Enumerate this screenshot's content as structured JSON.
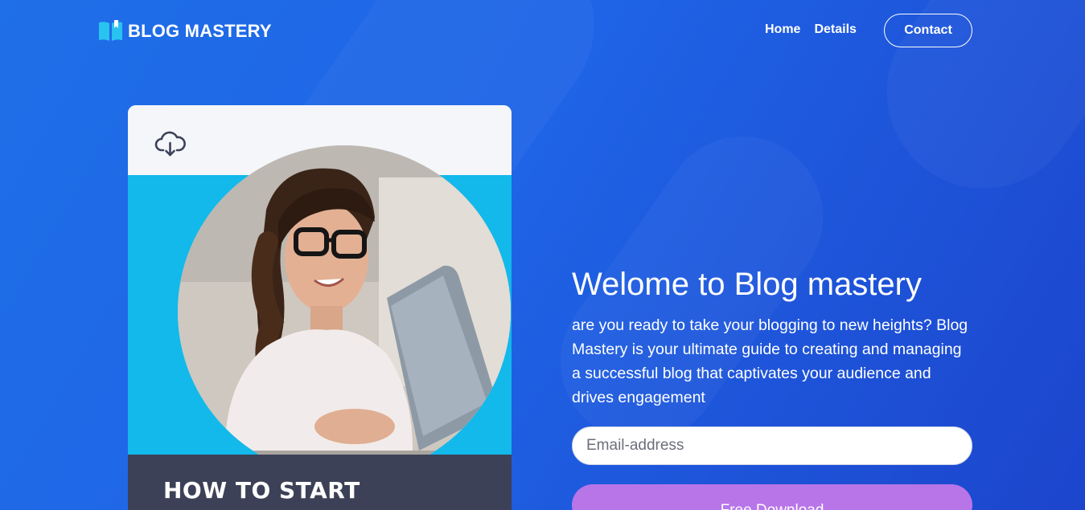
{
  "brand": {
    "name": "BLOG MASTERY",
    "icon": "book-icon"
  },
  "nav": {
    "home": "Home",
    "details": "Details",
    "contact": "Contact"
  },
  "card": {
    "icon": "cloud-download-icon",
    "heading": "HOW TO START"
  },
  "hero": {
    "title": "Welome to Blog mastery",
    "description": "are you ready to take your blogging to new heights? Blog Mastery is your ultimate guide to creating and managing a successful blog that captivates your audience and drives engagement"
  },
  "form": {
    "email_placeholder": "Email-address",
    "email_value": "",
    "download_label": "Free Download"
  },
  "colors": {
    "background": "#1f63e6",
    "card_accent": "#12b9ea",
    "card_footer": "#3d4157",
    "button": "#b875e8"
  }
}
